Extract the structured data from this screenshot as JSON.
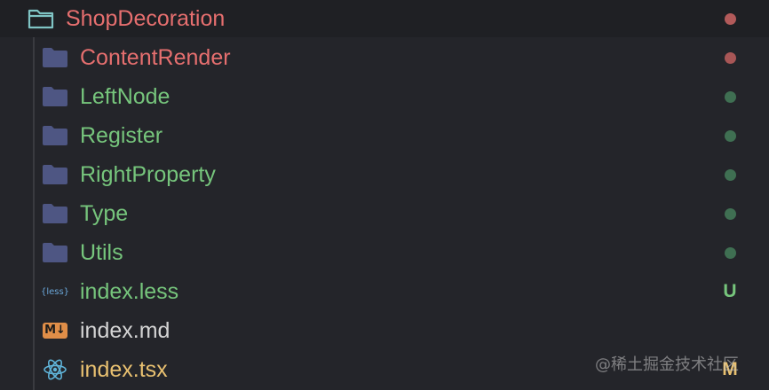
{
  "root": {
    "label": "ShopDecoration",
    "color": "#e66f6f",
    "status_dot_color": "#b25a5a"
  },
  "items": [
    {
      "label": "ContentRender",
      "icon": "folder-icon",
      "color": "#e66f6f",
      "status_dot_color": "#a85656"
    },
    {
      "label": "LeftNode",
      "icon": "folder-icon",
      "color": "#76c57c",
      "status_dot_color": "#3f6f52"
    },
    {
      "label": "Register",
      "icon": "folder-icon",
      "color": "#76c57c",
      "status_dot_color": "#3f6f52"
    },
    {
      "label": "RightProperty",
      "icon": "folder-icon",
      "color": "#76c57c",
      "status_dot_color": "#3f6f52"
    },
    {
      "label": "Type",
      "icon": "folder-icon",
      "color": "#76c57c",
      "status_dot_color": "#3f6f52"
    },
    {
      "label": "Utils",
      "icon": "folder-icon",
      "color": "#76c57c",
      "status_dot_color": "#3f6f52"
    },
    {
      "label": "index.less",
      "icon": "less-file-icon",
      "icon_text": "{less}",
      "color": "#76c57c",
      "status_text": "U",
      "status_color": "#76c57c"
    },
    {
      "label": "index.md",
      "icon": "markdown-file-icon",
      "icon_text": "M↓",
      "color": "#d4d4d4"
    },
    {
      "label": "index.tsx",
      "icon": "react-file-icon",
      "color": "#e8c070",
      "status_text": "M",
      "status_color": "#e8c070"
    }
  ],
  "watermark": "@稀土掘金技术社区"
}
